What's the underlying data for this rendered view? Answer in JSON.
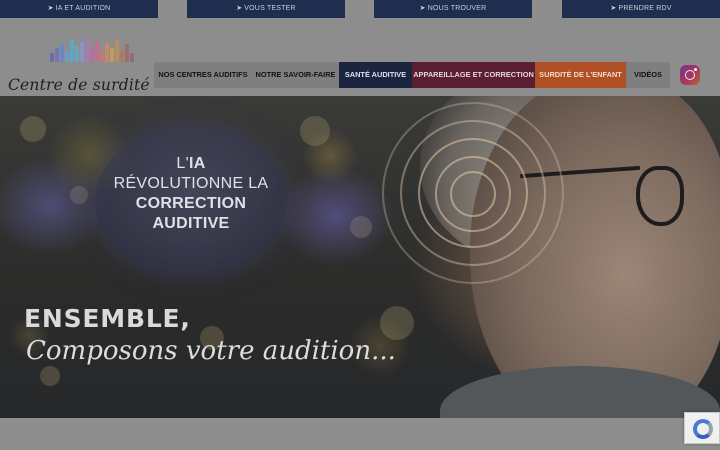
{
  "topbar": {
    "links": [
      {
        "arrow": "➤",
        "label": "IA ET AUDITION"
      },
      {
        "arrow": "➤",
        "label": "VOUS TESTER"
      },
      {
        "arrow": "➤",
        "label": "NOUS TROUVER"
      },
      {
        "arrow": "➤",
        "label": "PRENDRE RDV"
      }
    ]
  },
  "header": {
    "logo_text": "Centre de surdité",
    "nav": [
      {
        "label": "NOS CENTRES AUDITIFS"
      },
      {
        "label": "NOTRE SAVOIR-FAIRE"
      },
      {
        "label": "SANTÉ AUDITIVE"
      },
      {
        "label": "APPAREILLAGE ET CORRECTION"
      },
      {
        "label": "SURDITÉ DE L'ENFANT"
      },
      {
        "label": "VIDÉOS"
      }
    ],
    "social_icon": "instagram-icon"
  },
  "hero": {
    "circle_line1_prefix": "L'",
    "circle_line1_bold": "IA",
    "circle_line2": "RÉVOLUTIONNE LA",
    "circle_line3": "CORRECTION",
    "circle_line4": "AUDITIVE",
    "tagline_bold": "ENSEMBLE,",
    "tagline_script": "Composons votre audition..."
  },
  "widgets": {
    "recaptcha_icon": "recaptcha-icon"
  }
}
